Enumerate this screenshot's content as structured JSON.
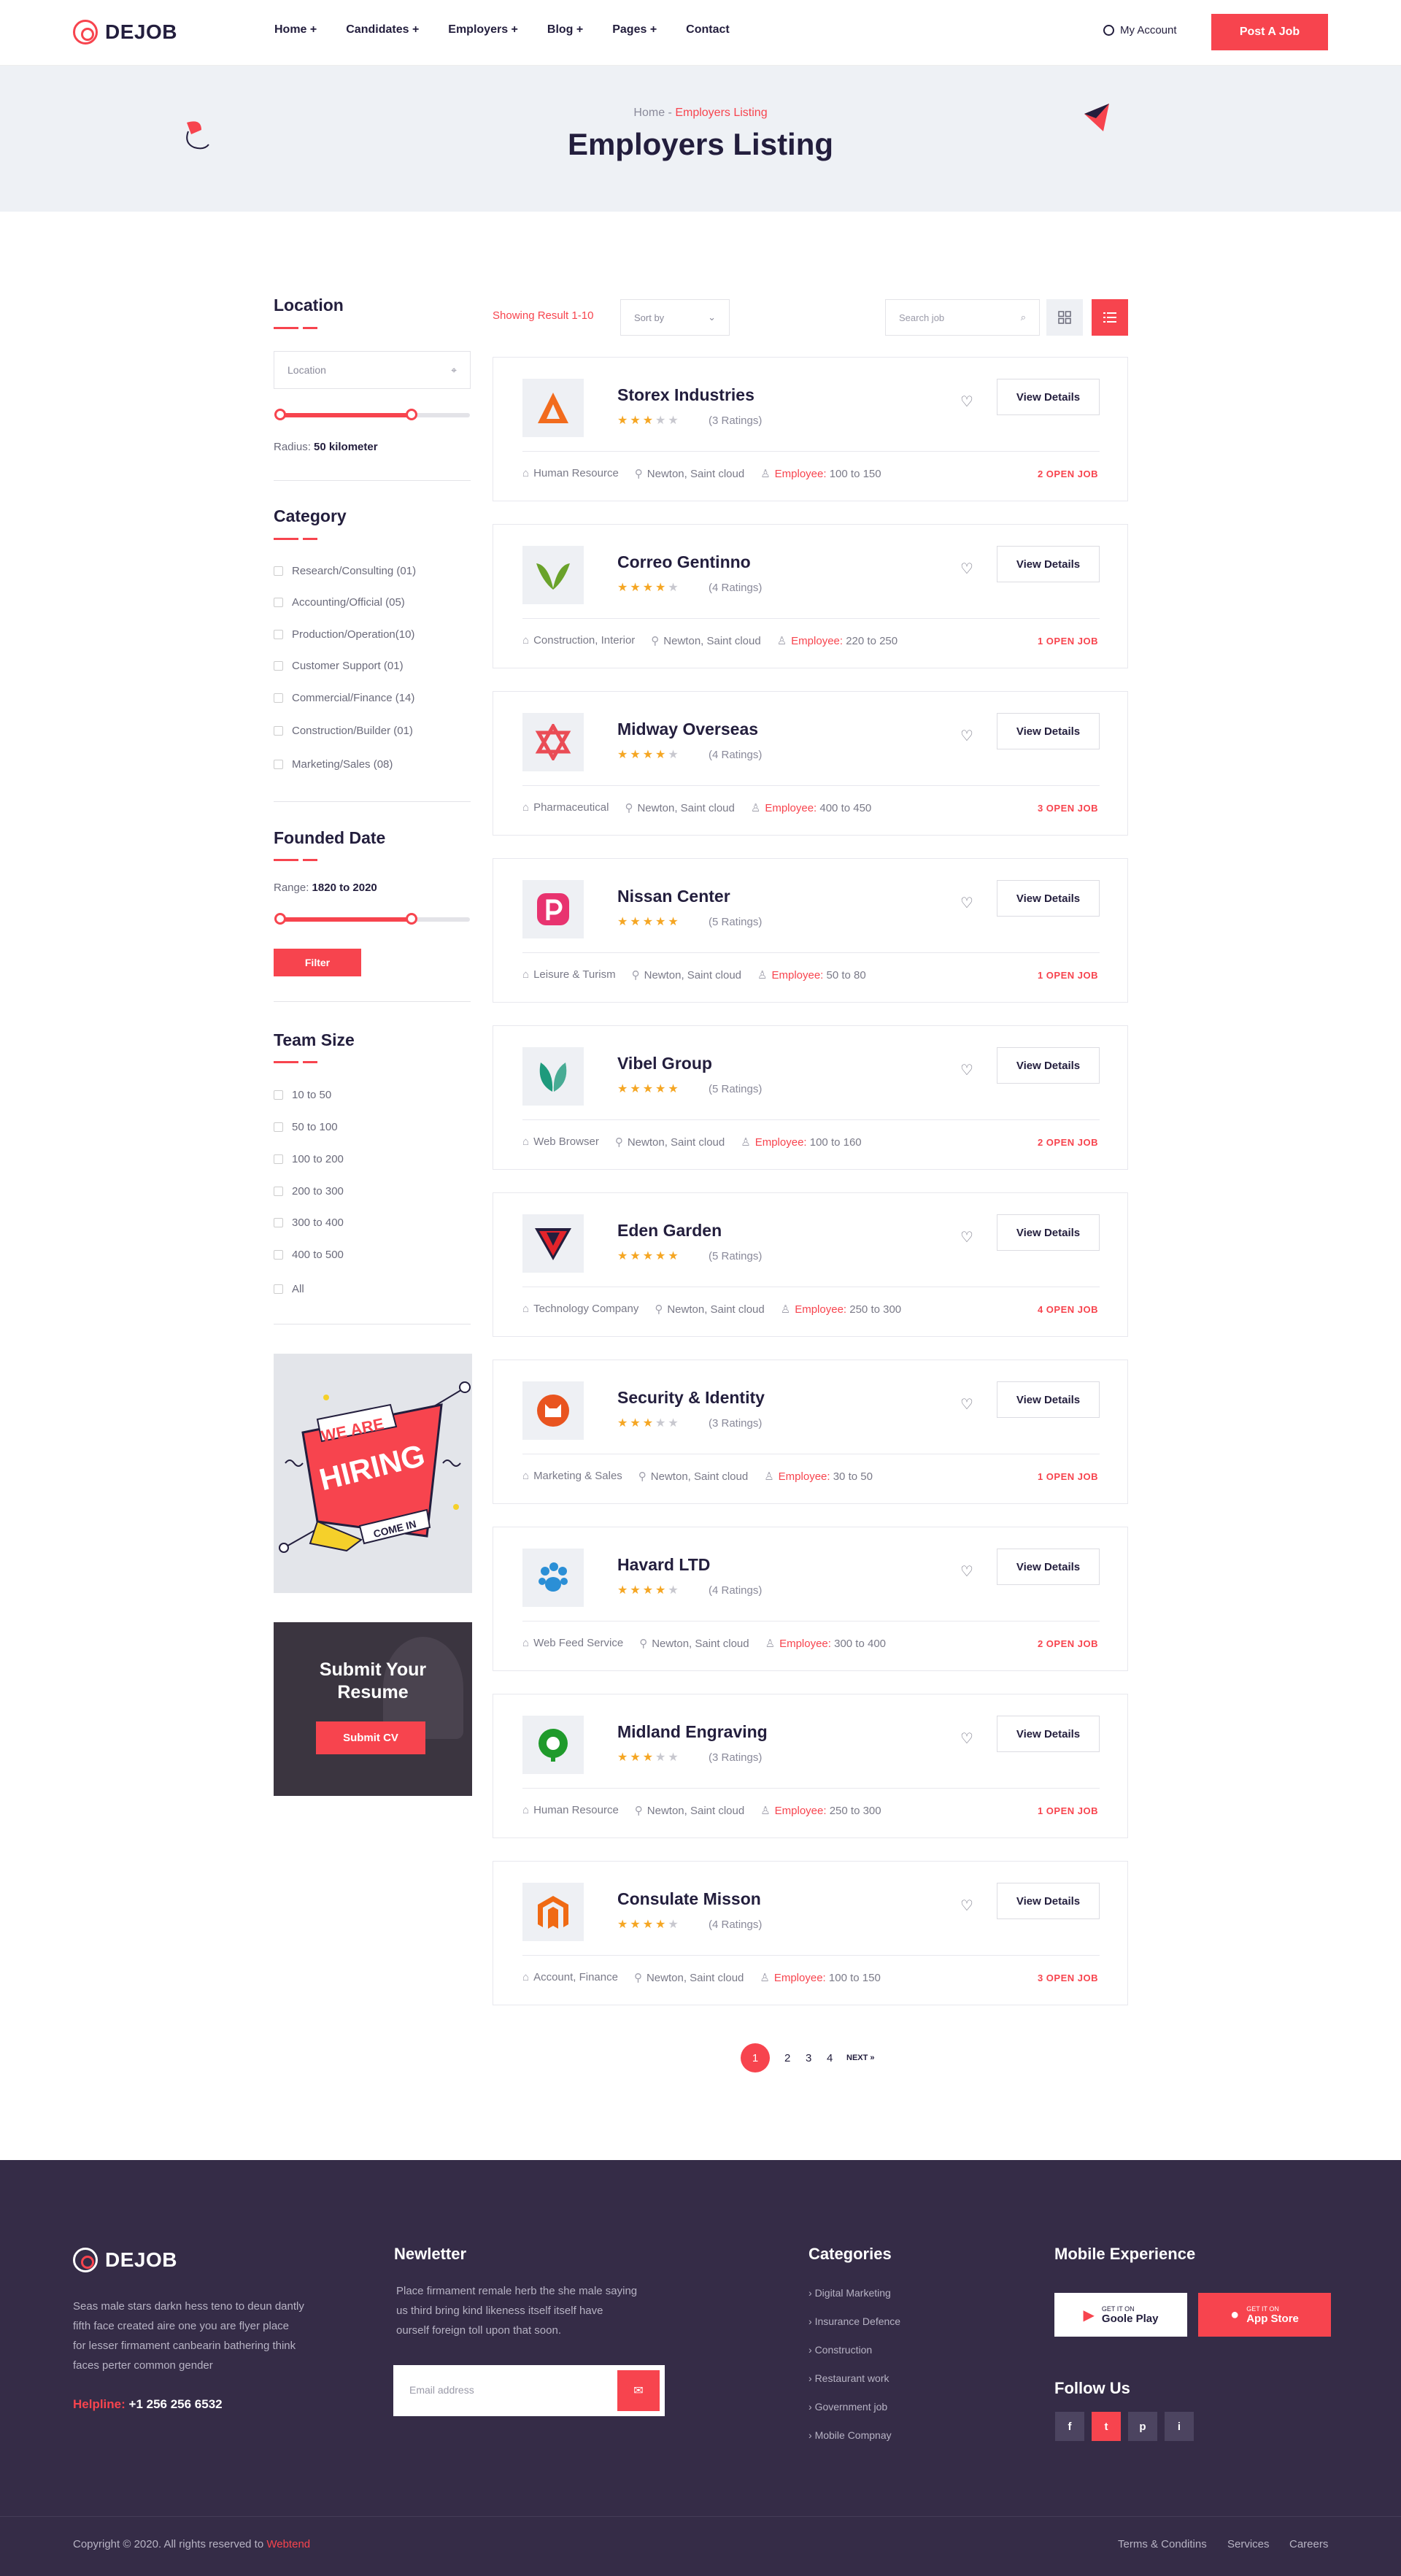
{
  "header": {
    "logo_text": "DEJOB",
    "nav": [
      "Home +",
      "Candidates +",
      "Employers +",
      "Blog +",
      "Pages +",
      "Contact"
    ],
    "account_label": "My Account",
    "post_job_label": "Post A Job"
  },
  "banner": {
    "crumb_home": "Home -",
    "crumb_current": "Employers Listing",
    "title": "Employers Listing"
  },
  "sidebar": {
    "location": {
      "title": "Location",
      "input_placeholder": "Location",
      "radius_label": "Radius:",
      "radius_value": "50 kilometer"
    },
    "category": {
      "title": "Category",
      "items": [
        "Research/Consulting (01)",
        "Accounting/Official (05)",
        "Production/Operation(10)",
        "Customer Support (01)",
        "Commercial/Finance (14)",
        "Construction/Builder (01)",
        "Marketing/Sales (08)"
      ]
    },
    "founded": {
      "title": "Founded Date",
      "range_label": "Range:",
      "range_value": "1820 to 2020",
      "filter_label": "Filter"
    },
    "team_size": {
      "title": "Team Size",
      "items": [
        "10 to 50",
        "50 to 100",
        "100 to 200",
        "200 to 300",
        "300 to 400",
        "400 to 500",
        "All"
      ]
    },
    "hiring_banner": {
      "line1": "WE ARE",
      "line2": "HIRING",
      "line3": "COME IN"
    },
    "submit_cv": {
      "title_line1": "Submit Your",
      "title_line2": "Resume",
      "button_label": "Submit CV"
    }
  },
  "listing": {
    "showing": "Showing Result 1-10",
    "sort_placeholder": "Sort by",
    "search_placeholder": "Search job",
    "employee_label": "Employee:",
    "view_label": "View Details",
    "employers": [
      {
        "name": "Storex Industries",
        "stars": 3,
        "ratings": "(3 Ratings)",
        "category": "Human Resource",
        "location": "Newton, Saint cloud",
        "employees": "100 to 150",
        "open_jobs": "2 OPEN JOB",
        "logo_color": "#f26b1d",
        "logo": "triangle"
      },
      {
        "name": "Correo Gentinno",
        "stars": 4,
        "ratings": "(4 Ratings)",
        "category": "Construction, Interior",
        "location": "Newton, Saint cloud",
        "employees": "220 to 250",
        "open_jobs": "1 OPEN JOB",
        "logo_color": "#6aa22a",
        "logo": "leaf-v"
      },
      {
        "name": "Midway Overseas",
        "stars": 4,
        "ratings": "(4 Ratings)",
        "category": "Pharmaceutical",
        "location": "Newton, Saint cloud",
        "employees": "400 to 450",
        "open_jobs": "3 OPEN JOB",
        "logo_color": "#ea4c55",
        "logo": "star"
      },
      {
        "name": "Nissan Center",
        "stars": 5,
        "ratings": "(5 Ratings)",
        "category": "Leisure & Turism",
        "location": "Newton, Saint cloud",
        "employees": "50 to 80",
        "open_jobs": "1 OPEN JOB",
        "logo_color": "#e8336f",
        "logo": "p"
      },
      {
        "name": "Vibel Group",
        "stars": 5,
        "ratings": "(5 Ratings)",
        "category": "Web Browser",
        "location": "Newton, Saint cloud",
        "employees": "100 to 160",
        "open_jobs": "2 OPEN JOB",
        "logo_color": "#1e9a7c",
        "logo": "leaves"
      },
      {
        "name": "Eden Garden",
        "stars": 5,
        "ratings": "(5 Ratings)",
        "category": "Technology Company",
        "location": "Newton, Saint cloud",
        "employees": "250 to 300",
        "open_jobs": "4 OPEN JOB",
        "logo_color": "#e3242b",
        "logo": "v"
      },
      {
        "name": "Security & Identity",
        "stars": 3,
        "ratings": "(3 Ratings)",
        "category": "Marketing & Sales",
        "location": "Newton, Saint cloud",
        "employees": "30 to 50",
        "open_jobs": "1 OPEN JOB",
        "logo_color": "#e9541f",
        "logo": "cat"
      },
      {
        "name": "Havard LTD",
        "stars": 4,
        "ratings": "(4 Ratings)",
        "category": "Web Feed Service",
        "location": "Newton, Saint cloud",
        "employees": "300 to 400",
        "open_jobs": "2 OPEN JOB",
        "logo_color": "#2b8fd6",
        "logo": "paw"
      },
      {
        "name": "Midland Engraving",
        "stars": 3,
        "ratings": "(3 Ratings)",
        "category": "Human Resource",
        "location": "Newton, Saint cloud",
        "employees": "250 to 300",
        "open_jobs": "1 OPEN JOB",
        "logo_color": "#1f9a2b",
        "logo": "circle"
      },
      {
        "name": "Consulate Misson",
        "stars": 4,
        "ratings": "(4 Ratings)",
        "category": "Account, Finance",
        "location": "Newton, Saint cloud",
        "employees": "100 to 150",
        "open_jobs": "3 OPEN JOB",
        "logo_color": "#f06a14",
        "logo": "magento"
      }
    ]
  },
  "pagination": {
    "pages": [
      "1",
      "2",
      "3",
      "4"
    ],
    "next_label": "NEXT »"
  },
  "footer": {
    "logo_text": "DEJOB",
    "about_lines": [
      "Seas male stars darkn hess teno to deun dantly",
      "fifth face created aire one you are flyer place",
      "for lesser firmament canbearin bathering think",
      "faces perter common gender"
    ],
    "helpline_label": "Helpline:",
    "helpline_number": "+1 256 256 6532",
    "newsletter_title": "Newletter",
    "newsletter_lines": [
      "Place firmament remale herb the she male saying",
      "us third bring kind likeness itself itself have",
      "ourself  foreign toll upon that soon."
    ],
    "email_placeholder": "Email address",
    "categories_title": "Categories",
    "categories": [
      "Digital Marketing",
      "Insurance Defence",
      "Construction",
      "Restaurant work",
      "Government job",
      "Mobile Compnay"
    ],
    "mobile_title": "Mobile Experience",
    "google_small": "GET IT ON",
    "google_big": "Goole Play",
    "apple_small": "GET IT ON",
    "apple_big": "App Store",
    "follow_title": "Follow Us",
    "social": [
      "f",
      "t",
      "p",
      "i"
    ],
    "copyright": "Copyright © 2020. All rights reserved to",
    "copyright_brand": "Webtend",
    "bottom_links": [
      "Terms & Conditins",
      "Services",
      "Careers"
    ]
  },
  "colors": {
    "accent": "#f7444e",
    "dark": "#231e3d",
    "star": "#f5a623",
    "footer_bg": "#352c47"
  }
}
